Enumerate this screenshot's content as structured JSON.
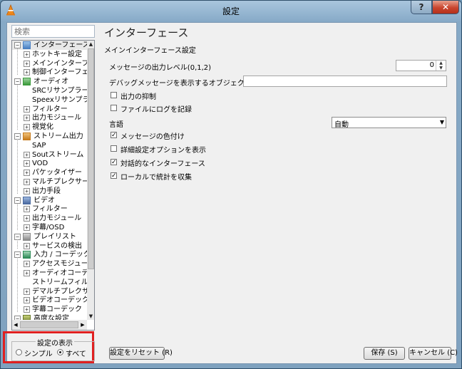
{
  "window": {
    "title": "設定",
    "help_label": "?",
    "close_label": "✕"
  },
  "sidebar": {
    "search_placeholder": "検索",
    "tree": [
      {
        "label": "インターフェース",
        "level": 0,
        "expander": "-",
        "icon": "interface-icon",
        "selected": true
      },
      {
        "label": "ホットキー設定",
        "level": 1,
        "expander": "+"
      },
      {
        "label": "メインインターフェー",
        "level": 1,
        "expander": "+"
      },
      {
        "label": "制御インターフェー",
        "level": 1,
        "expander": "+"
      },
      {
        "label": "オーディオ",
        "level": 0,
        "expander": "-",
        "icon": "audio-icon"
      },
      {
        "label": "SRCリサンプラー",
        "level": 1,
        "expander": ""
      },
      {
        "label": "Speexリサンプラー",
        "level": 1,
        "expander": ""
      },
      {
        "label": "フィルター",
        "level": 1,
        "expander": "+"
      },
      {
        "label": "出力モジュール",
        "level": 1,
        "expander": "+"
      },
      {
        "label": "視覚化",
        "level": 1,
        "expander": "+"
      },
      {
        "label": "ストリーム出力",
        "level": 0,
        "expander": "-",
        "icon": "stream-output-icon"
      },
      {
        "label": "SAP",
        "level": 1,
        "expander": ""
      },
      {
        "label": "Soutストリーム",
        "level": 1,
        "expander": "+"
      },
      {
        "label": "VOD",
        "level": 1,
        "expander": "+"
      },
      {
        "label": "パケッタイザー",
        "level": 1,
        "expander": "+"
      },
      {
        "label": "マルチプレクサー",
        "level": 1,
        "expander": "+"
      },
      {
        "label": "出力手段",
        "level": 1,
        "expander": "+"
      },
      {
        "label": "ビデオ",
        "level": 0,
        "expander": "-",
        "icon": "video-icon"
      },
      {
        "label": "フィルター",
        "level": 1,
        "expander": "+"
      },
      {
        "label": "出力モジュール",
        "level": 1,
        "expander": "+"
      },
      {
        "label": "字幕/OSD",
        "level": 1,
        "expander": "+"
      },
      {
        "label": "プレイリスト",
        "level": 0,
        "expander": "-",
        "icon": "playlist-icon"
      },
      {
        "label": "サービスの検出",
        "level": 1,
        "expander": "+"
      },
      {
        "label": "入力 / コーデック",
        "level": 0,
        "expander": "-",
        "icon": "input-codec-icon"
      },
      {
        "label": "アクセスモジュール",
        "level": 1,
        "expander": "+"
      },
      {
        "label": "オーディオコーデッ",
        "level": 1,
        "expander": "+"
      },
      {
        "label": "ストリームフィルター",
        "level": 1,
        "expander": ""
      },
      {
        "label": "デマルチプレクサー",
        "level": 1,
        "expander": "+"
      },
      {
        "label": "ビデオコーデック",
        "level": 1,
        "expander": "+"
      },
      {
        "label": "字幕コーデック",
        "level": 1,
        "expander": "+"
      },
      {
        "label": "高度な設定",
        "level": 0,
        "expander": "-",
        "icon": "advanced-icon"
      }
    ],
    "show_settings": {
      "legend": "設定の表示",
      "simple_label": "シンプル",
      "all_label": "すべて",
      "selected": "all"
    },
    "reset_button": "設定をリセット (R)"
  },
  "main": {
    "title": "インターフェース",
    "section": "メインインターフェース設定",
    "verbosity_label": "メッセージの出力レベル(0,1,2)",
    "verbosity_value": "0",
    "debug_objects_label": "デバッグメッセージを表示するオブジェクトの選択",
    "debug_objects_value": "",
    "options": [
      {
        "label": "出力の抑制",
        "checked": false
      },
      {
        "label": "ファイルにログを記録",
        "checked": false
      }
    ],
    "language_label": "言語",
    "language_value": "自動",
    "options2": [
      {
        "label": "メッセージの色付け",
        "checked": true
      },
      {
        "label": "詳細設定オプションを表示",
        "checked": false
      },
      {
        "label": "対話的なインターフェース",
        "checked": true
      },
      {
        "label": "ローカルで統計を収集",
        "checked": true
      }
    ]
  },
  "footer": {
    "save_button": "保存 (S)",
    "cancel_button": "キャンセル (C)"
  }
}
